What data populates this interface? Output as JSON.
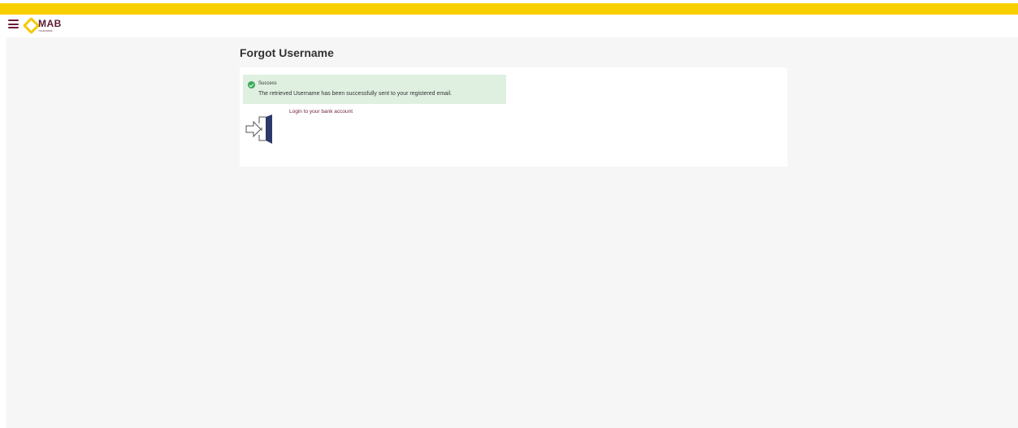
{
  "header": {
    "menu_icon": "hamburger-menu-icon",
    "logo_text": "MAB",
    "logo_tagline": "YOUR BANK"
  },
  "page": {
    "title": "Forgot Username"
  },
  "alert": {
    "status": "success",
    "title": "Success",
    "message": "The retrieved Username has been successfully sent to your registered email."
  },
  "login": {
    "icon": "login-door-icon",
    "link_text": "Login to your bank account"
  },
  "colors": {
    "accent_yellow": "#f8d000",
    "brand_maroon": "#6b1d3c",
    "success_bg": "#dff0e1",
    "success_icon": "#3aa85a",
    "page_bg": "#f6f6f6"
  }
}
